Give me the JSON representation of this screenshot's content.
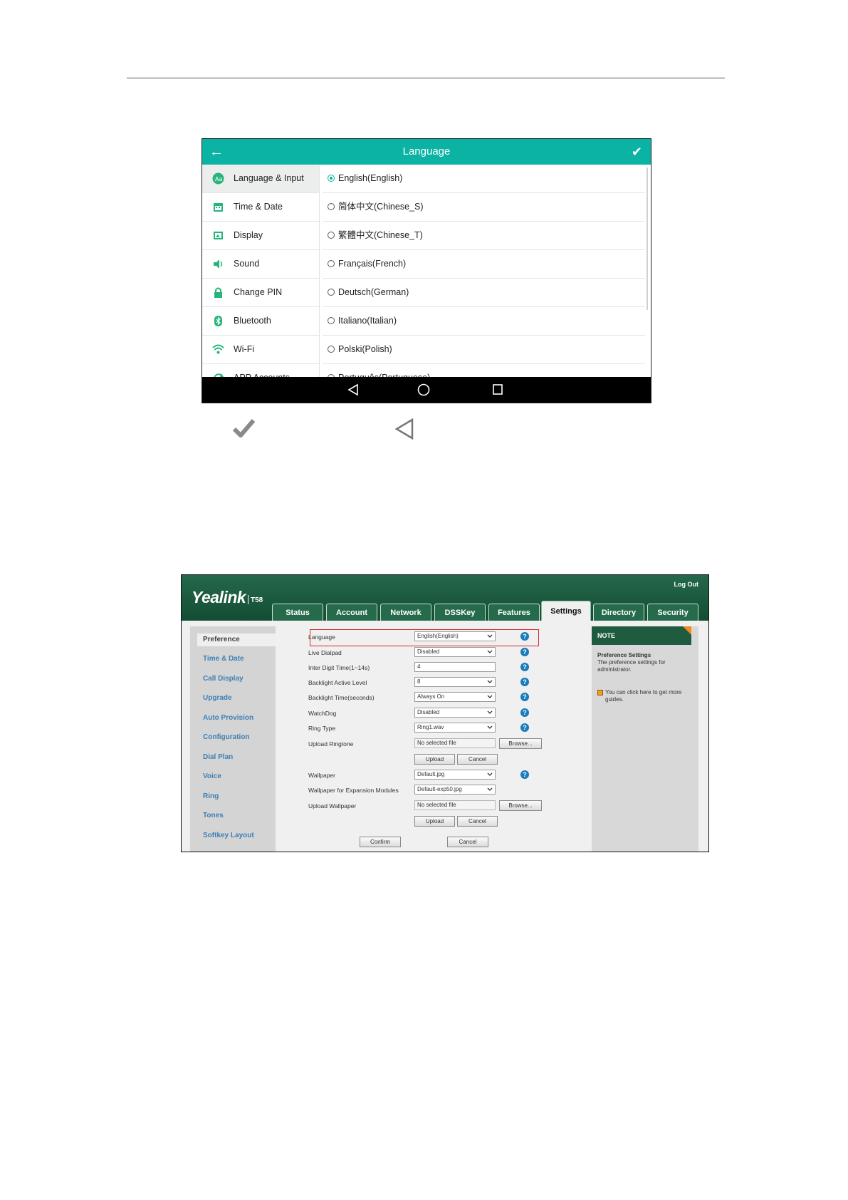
{
  "phone": {
    "title": "Language",
    "menu": [
      {
        "label": "Language & Input",
        "icon": "language-input-icon"
      },
      {
        "label": "Time & Date",
        "icon": "calendar-icon"
      },
      {
        "label": "Display",
        "icon": "display-icon"
      },
      {
        "label": "Sound",
        "icon": "speaker-icon"
      },
      {
        "label": "Change PIN",
        "icon": "lock-icon"
      },
      {
        "label": "Bluetooth",
        "icon": "bluetooth-icon"
      },
      {
        "label": "Wi-Fi",
        "icon": "wifi-icon"
      },
      {
        "label": "APP Accounts",
        "icon": "sync-icon"
      }
    ],
    "languages": [
      "English(English)",
      "简体中文(Chinese_S)",
      "繁體中文(Chinese_T)",
      "Français(French)",
      "Deutsch(German)",
      "Italiano(Italian)",
      "Polski(Polish)",
      "Português(Portuguese)"
    ],
    "selected_language": "English(English)",
    "accent_color": "#0ab3a3"
  },
  "web": {
    "logo": "Yealink",
    "model": "T58",
    "logout": "Log Out",
    "tabs": [
      "Status",
      "Account",
      "Network",
      "DSSKey",
      "Features",
      "Settings",
      "Directory",
      "Security"
    ],
    "active_tab": "Settings",
    "sidebar": [
      "Preference",
      "Time & Date",
      "Call Display",
      "Upgrade",
      "Auto Provision",
      "Configuration",
      "Dial Plan",
      "Voice",
      "Ring",
      "Tones",
      "Softkey Layout"
    ],
    "fields": {
      "language": {
        "label": "Language",
        "value": "English(English)"
      },
      "live_dialpad": {
        "label": "Live Dialpad",
        "value": "Disabled"
      },
      "inter_digit": {
        "label": "Inter Digit Time(1~14s)",
        "value": "4"
      },
      "backlight_level": {
        "label": "Backlight Active Level",
        "value": "8"
      },
      "backlight_time": {
        "label": "Backlight Time(seconds)",
        "value": "Always On"
      },
      "watchdog": {
        "label": "WatchDog",
        "value": "Disabled"
      },
      "ring_type": {
        "label": "Ring Type",
        "value": "Ring1.wav"
      },
      "upload_ringtone": {
        "label": "Upload Ringtone",
        "value": "No selected file"
      },
      "wallpaper": {
        "label": "Wallpaper",
        "value": "Default.jpg"
      },
      "wallpaper_exp": {
        "label": "Wallpaper for Expansion Modules",
        "value": "Default-exp50.jpg"
      },
      "upload_wallpaper": {
        "label": "Upload Wallpaper",
        "value": "No selected file"
      }
    },
    "buttons": {
      "browse": "Browse...",
      "upload": "Upload",
      "cancel": "Cancel",
      "confirm": "Confirm"
    },
    "note": {
      "heading": "NOTE",
      "title": "Preference Settings",
      "text": "The preference settings for administrator.",
      "guide": "You can click here to get more guides."
    },
    "help_glyph": "?",
    "highlight_color": "#d42a2a",
    "link_color": "#3e7fb5"
  }
}
